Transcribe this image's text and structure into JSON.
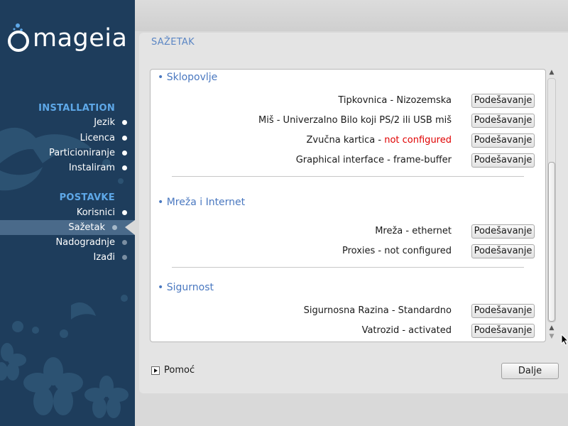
{
  "sidebar": {
    "logo_text": "mageia",
    "installation_title": "INSTALLATION",
    "installation_steps": [
      "Jezik",
      "Licenca",
      "Particioniranje",
      "Instaliram"
    ],
    "postavke_title": "POSTAVKE",
    "postavke_steps": [
      "Korisnici",
      "Sažetak",
      "Nadogradnje",
      "Izađi"
    ],
    "current_step": "Sažetak"
  },
  "page": {
    "title": "SAŽETAK"
  },
  "summary": {
    "hardware": {
      "title": "• Sklopovlje",
      "rows": [
        {
          "label": "Tipkovnica - Nizozemska",
          "warn": "",
          "button": "Podešavanje"
        },
        {
          "label": "Miš - Univerzalno Bilo koji PS/2 ili USB miš",
          "warn": "",
          "button": "Podešavanje"
        },
        {
          "label": "Zvučna kartica - ",
          "warn": "not configured",
          "button": "Podešavanje"
        },
        {
          "label": "Graphical interface - frame-buffer",
          "warn": "",
          "button": "Podešavanje"
        }
      ]
    },
    "network": {
      "title": "• Mreža i Internet",
      "rows": [
        {
          "label": "Mreža - ethernet",
          "button": "Podešavanje"
        },
        {
          "label": "Proxies - not configured",
          "button": "Podešavanje"
        }
      ]
    },
    "security": {
      "title": "• Sigurnost",
      "rows": [
        {
          "label": "Sigurnosna Razina - Standardno",
          "button": "Podešavanje"
        },
        {
          "label": "Vatrozid - activated",
          "button": "Podešavanje"
        }
      ]
    }
  },
  "footer": {
    "help_label": "Pomoć",
    "next_label": "Dalje"
  },
  "colors": {
    "sidebar_bg": "#1e3d5c",
    "section_title": "#5ea8e8",
    "category_title": "#4a78c0",
    "warning": "#e00000"
  }
}
